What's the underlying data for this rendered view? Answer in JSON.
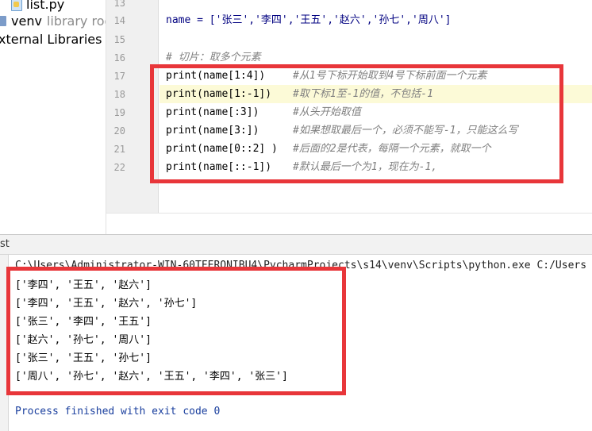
{
  "project_tree": {
    "items": [
      {
        "label": "list.py",
        "icon": "python-file-icon"
      },
      {
        "label": "venv",
        "suffix": "library root",
        "icon": "folder-icon"
      },
      {
        "label": "xternal Libraries"
      }
    ]
  },
  "editor": {
    "lines": [
      {
        "no": "13",
        "code": ""
      },
      {
        "no": "14",
        "code": "name = ['张三','李四','王五','赵六','孙七','周八']"
      },
      {
        "no": "15",
        "code": ""
      },
      {
        "no": "16",
        "code": "# 切片：取多个元素"
      },
      {
        "no": "17",
        "code": "print(name[1:4])",
        "comment": "#从1号下标开始取到4号下标前面一个元素"
      },
      {
        "no": "18",
        "code": "print(name[1:-1])",
        "comment": "#取下标1至-1的值，不包括-1"
      },
      {
        "no": "19",
        "code": "print(name[:3])",
        "comment": "#从头开始取值"
      },
      {
        "no": "20",
        "code": "print(name[3:])",
        "comment": "#如果想取最后一个，必须不能写-1，只能这么写"
      },
      {
        "no": "21",
        "code": "print(name[0::2] )",
        "comment": "#后面的2是代表，每隔一个元素，就取一个"
      },
      {
        "no": "22",
        "code": "print(name[::-1])",
        "comment": "#默认最后一个为1，现在为-1,"
      }
    ],
    "current_line": "18"
  },
  "run_panel": {
    "title": "st",
    "command": "C:\\Users\\Administrator-WIN-60TFERONIBU4\\PycharmProjects\\s14\\venv\\Scripts\\python.exe C:/Users",
    "output": [
      "['李四', '王五', '赵六']",
      "['李四', '王五', '赵六', '孙七']",
      "['张三', '李四', '王五']",
      "['赵六', '孙七', '周八']",
      "['张三', '王五', '孙七']",
      "['周八', '孙七', '赵六', '王五', '李四', '张三']"
    ],
    "exit_message": "Process finished with exit code 0"
  },
  "colors": {
    "annotation_red": "#e8363a",
    "current_line_bg": "#fcfad7",
    "string_green": "#008000",
    "comment_gray": "#808080"
  }
}
